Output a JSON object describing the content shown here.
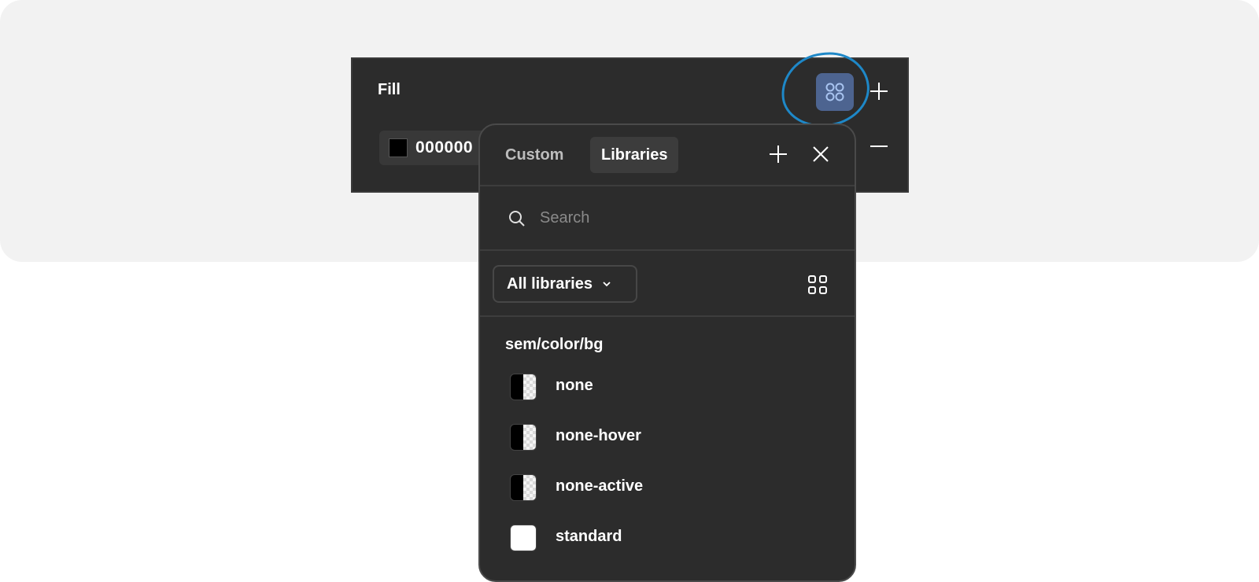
{
  "fill_panel": {
    "title": "Fill",
    "color_value": "000000"
  },
  "popover": {
    "tabs": [
      {
        "label": "Custom",
        "active": false
      },
      {
        "label": "Libraries",
        "active": true
      }
    ],
    "search": {
      "placeholder": "Search",
      "value": ""
    },
    "library_filter": {
      "selected": "All libraries"
    },
    "group_title": "sem/color/bg",
    "styles": [
      {
        "label": "none",
        "swatch": "transparent-half"
      },
      {
        "label": "none-hover",
        "swatch": "transparent-half"
      },
      {
        "label": "none-active",
        "swatch": "transparent-half"
      },
      {
        "label": "standard",
        "swatch": "white"
      }
    ]
  },
  "colors": {
    "panel_bg": "#2c2c2c",
    "accent_button": "#4d6490",
    "highlight_ring": "#1e88c8"
  },
  "icons": [
    "styles-grid-icon",
    "plus-icon",
    "minus-icon",
    "close-icon",
    "search-icon",
    "chevron-down-icon",
    "grid-view-icon"
  ]
}
